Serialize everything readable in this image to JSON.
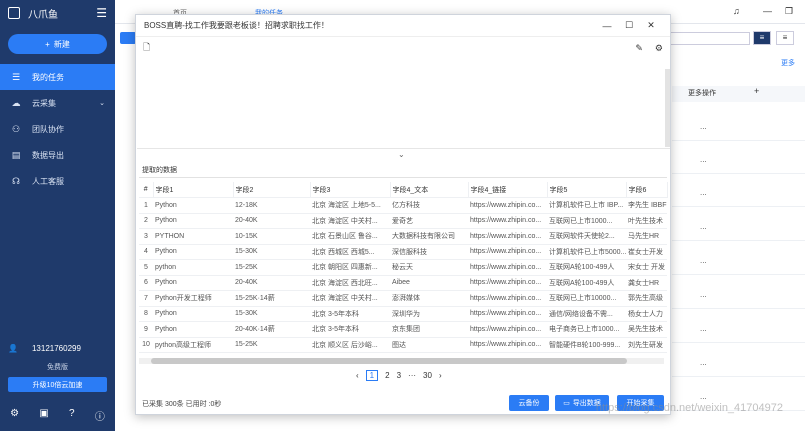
{
  "sidebar": {
    "logo_text": "八爪鱼",
    "new_button": "新建",
    "items": [
      {
        "label": "我的任务",
        "icon": "list-icon"
      },
      {
        "label": "云采集",
        "icon": "cloud-icon"
      },
      {
        "label": "团队协作",
        "icon": "team-icon"
      },
      {
        "label": "数据导出",
        "icon": "export-icon"
      },
      {
        "label": "人工客服",
        "icon": "headset-icon"
      }
    ],
    "user_phone": "13121760299",
    "user_role": "免费版",
    "upgrade_button": "升级10倍云加速"
  },
  "background": {
    "tab1": "首页",
    "tab2": "我的任务",
    "more_link": "更多",
    "more_ops_header": "更多操作",
    "row_ellipsis": "..."
  },
  "modal": {
    "title": "BOSS直聘-找工作我要跟老板谈！招聘求职找工作！",
    "tab_label": "提取的数据",
    "columns": [
      "#",
      "字段1",
      "字段2",
      "字段3",
      "字段4_文本",
      "字段4_链接",
      "字段5",
      "字段6"
    ],
    "rows": [
      [
        "1",
        "Python",
        "12-18K",
        "北京 海淀区 上地5-5...",
        "亿方科技",
        "https://www.zhipin.co...",
        "计算机软件已上市 IBP...",
        "李先生 IBBF"
      ],
      [
        "2",
        "Python",
        "20-40K",
        "北京 海淀区 中关村...",
        "爱奇艺",
        "https://www.zhipin.co...",
        "互联网已上市1000...",
        "叶先生技术"
      ],
      [
        "3",
        "PYTHON",
        "10-15K",
        "北京 石景山区 鲁谷...",
        "大数据科技有限公司",
        "https://www.zhipin.co...",
        "互联网软件天使轮2...",
        "马先生HR"
      ],
      [
        "4",
        "Python",
        "15-30K",
        "北京 西城区 西城5...",
        "深信服科技",
        "https://www.zhipin.co...",
        "计算机软件已上市5000...",
        "崔女士开发"
      ],
      [
        "5",
        "python",
        "15-25K",
        "北京 朝阳区 四惠新...",
        "秘云天",
        "https://www.zhipin.co...",
        "互联网A轮100-499人",
        "宋女士 开发"
      ],
      [
        "6",
        "Python",
        "20-40K",
        "北京 海淀区 西北旺...",
        "Aibee",
        "https://www.zhipin.co...",
        "互联网A轮100-499人",
        "龚女士HR"
      ],
      [
        "7",
        "Python开发工程师",
        "15-25K·14薪",
        "北京 海淀区 中关村...",
        "澎湃媒体",
        "https://www.zhipin.co...",
        "互联网已上市10000...",
        "郭先生高级"
      ],
      [
        "8",
        "Python",
        "15-30K",
        "北京 3-5年本科",
        "深圳华为",
        "https://www.zhipin.co...",
        "通信/网络设备不需...",
        "杨女士人力"
      ],
      [
        "9",
        "Python",
        "20-40K·14薪",
        "北京 3-5年本科",
        "京东集团",
        "https://www.zhipin.co...",
        "电子商务已上市1000...",
        "吴先生技术"
      ],
      [
        "10",
        "python高级工程师",
        "15-25K",
        "北京 顺义区 后沙峪...",
        "图达",
        "https://www.zhipin.co...",
        "智能硬件B轮100-999...",
        "刘先生研发"
      ]
    ],
    "pages": [
      "1",
      "2",
      "3",
      "···",
      "30"
    ],
    "prev": "‹",
    "next": "›",
    "status": "已采集 300条 已用时 :0秒",
    "buttons": {
      "cloud": "云备份",
      "export": "导出数据",
      "start": "开始采集"
    }
  },
  "watermark": "https://blog.csdn.net/weixin_41704972"
}
